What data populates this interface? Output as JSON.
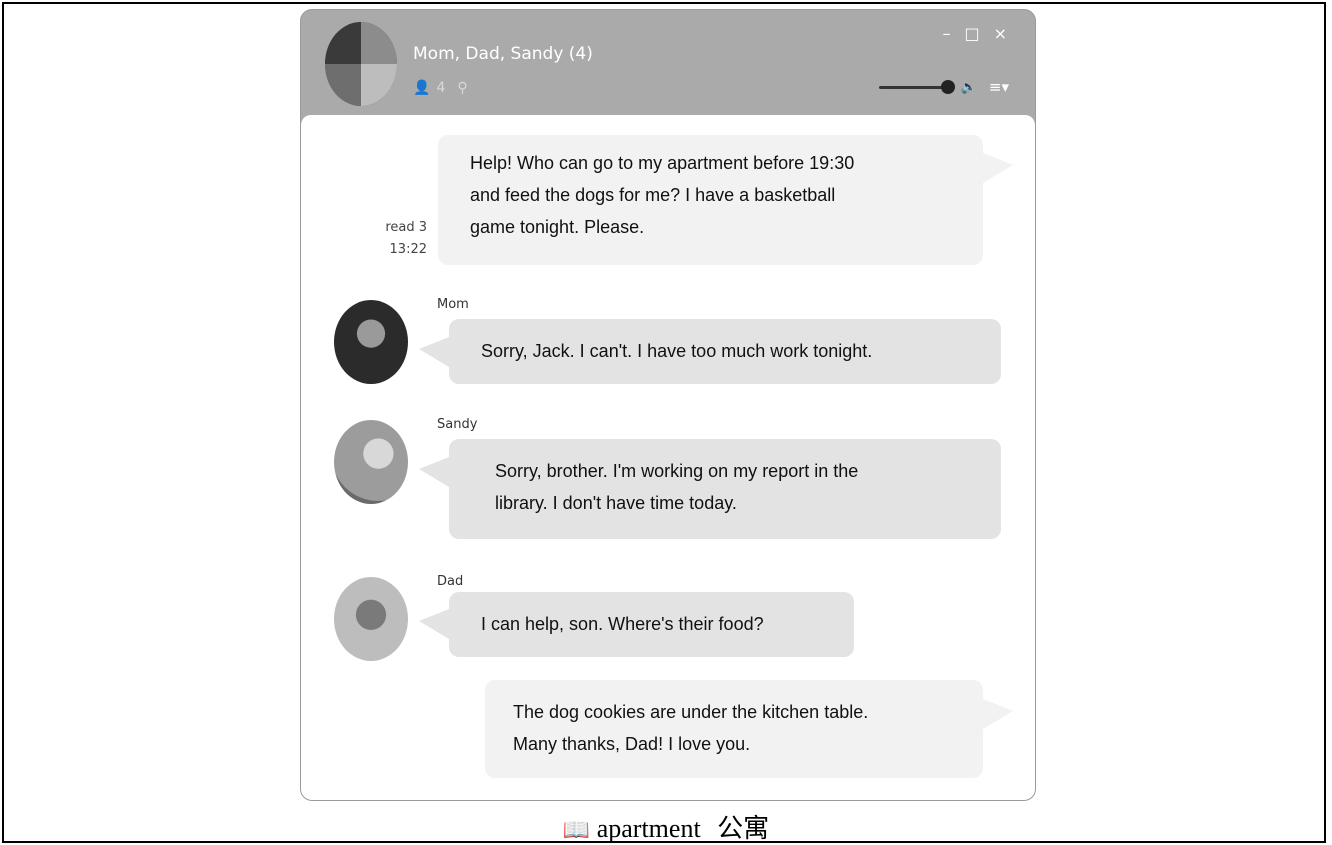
{
  "window": {
    "title": "Mom, Dad, Sandy (4)",
    "member_count": "4",
    "controls": {
      "minimize": "–",
      "maximize": "□",
      "close": "×"
    },
    "volume_level": 1.0
  },
  "messages": [
    {
      "sender": "",
      "side": "me",
      "lines": [
        "Help!  Who can go to my apartment before 19:30",
        "and feed the dogs for me?  I have a basketball",
        "game tonight.  Please."
      ],
      "read": "read 3",
      "time": "13:22"
    },
    {
      "sender": "Mom",
      "side": "other",
      "lines": [
        "Sorry, Jack.  I can't.  I have too much work tonight."
      ]
    },
    {
      "sender": "Sandy",
      "side": "other",
      "lines": [
        "Sorry, brother.  I'm working on my report in the",
        "library.  I don't have time today."
      ]
    },
    {
      "sender": "Dad",
      "side": "other",
      "lines": [
        "I can help, son.  Where's their food?"
      ]
    },
    {
      "sender": "",
      "side": "me",
      "lines": [
        "The dog cookies are under the kitchen table.",
        "Many thanks, Dad!  I love you."
      ]
    }
  ],
  "caption": {
    "icon": "book-icon",
    "word": "apartment",
    "translation": "公寓"
  }
}
